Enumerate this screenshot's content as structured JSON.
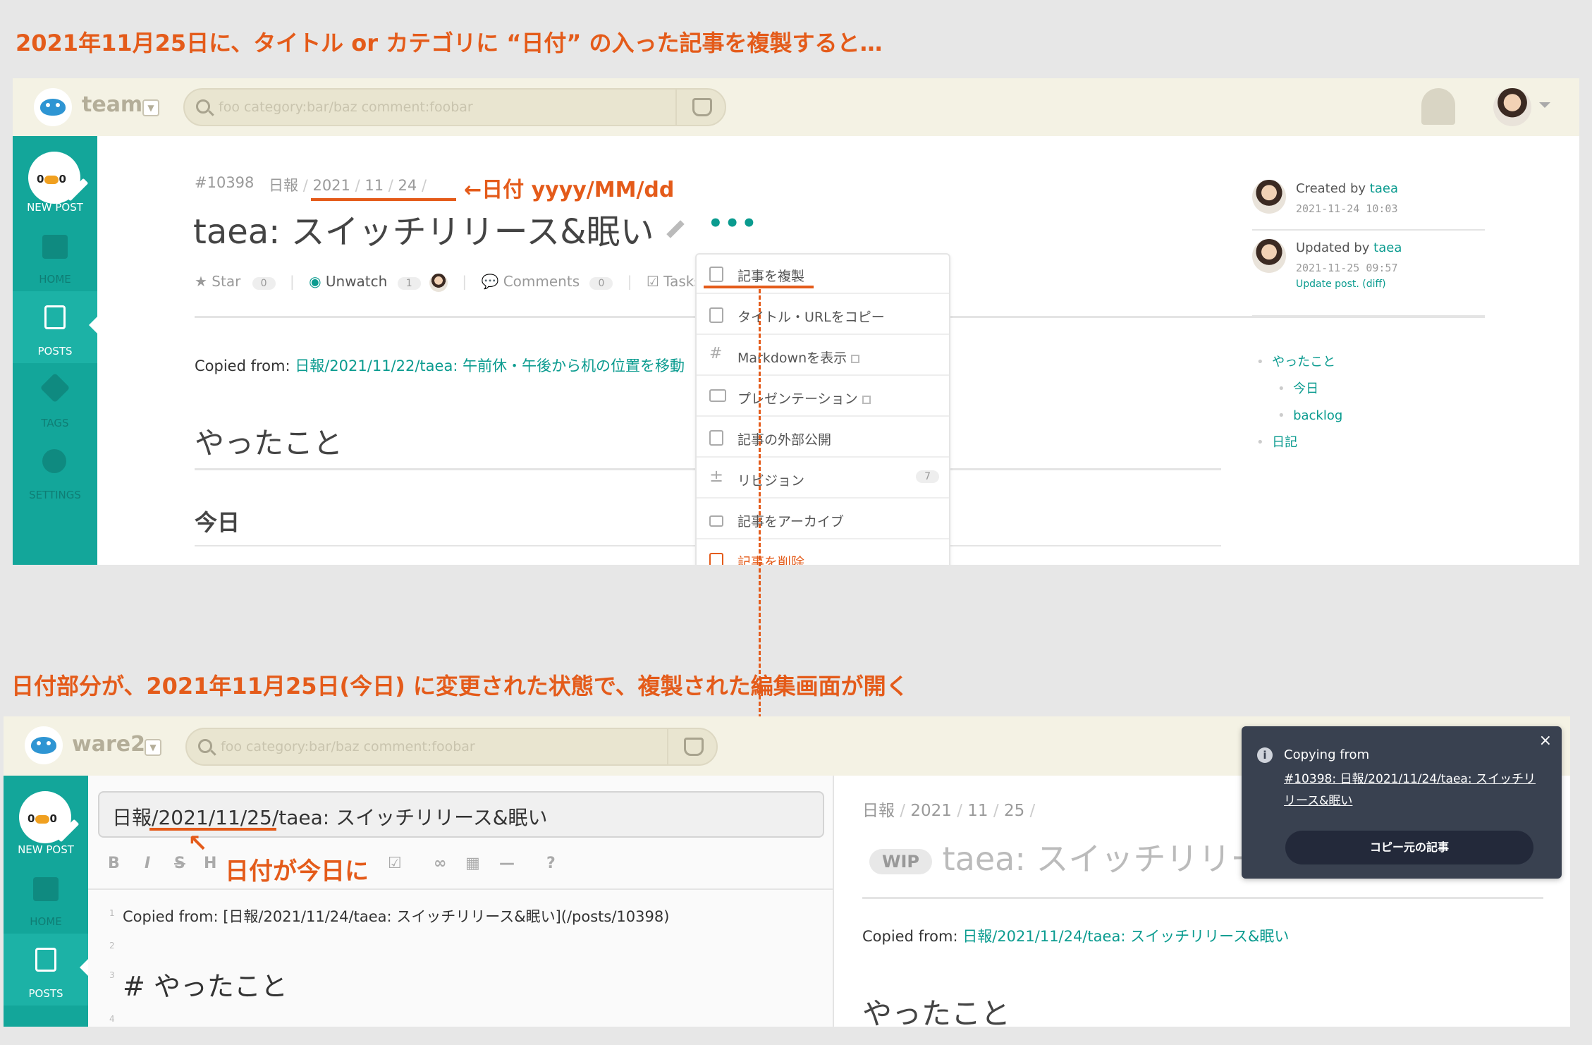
{
  "annotations": {
    "top_heading": "2021年11月25日に、タイトル or カテゴリに “日付” の入った記事を複製すると…",
    "date_format": "←日付 yyyy/MM/dd",
    "mid_heading": "日付部分が、2021年11月25日(今日) に変更された状態で、複製された編集画面が開く",
    "date_today": "日付が今日に",
    "accent_color": "#e45b1a"
  },
  "top": {
    "team": "team",
    "search_placeholder": "foo category:bar/baz comment:foobar",
    "sidebar": {
      "new_post": "NEW POST",
      "home": "HOME",
      "posts": "POSTS",
      "tags": "TAGS",
      "settings": "SETTINGS"
    },
    "post": {
      "number": "#10398",
      "category": "日報",
      "year": "2021",
      "month": "11",
      "day": "24",
      "title": "taea: スイッチリリース&眠い",
      "star": "Star",
      "star_count": "0",
      "unwatch": "Unwatch",
      "watch_count": "1",
      "comments": "Comments",
      "comment_count": "0",
      "tasks": "Tasks",
      "copied_from_label": "Copied from:",
      "copied_from_link": "日報/2021/11/22/taea: 午前休・午後から机の位置を移動",
      "h1": "やったこと",
      "h2": "今日"
    },
    "menu": {
      "duplicate": "記事を複製",
      "copy_title": "タイトル・URLをコピー",
      "markdown": "Markdownを表示",
      "presentation": "プレゼンテーション",
      "share": "記事の外部公開",
      "revision": "リビジョン",
      "revision_count": "7",
      "archive": "記事をアーカイブ",
      "delete": "記事を削除"
    },
    "meta": {
      "created_label": "Created by",
      "created_user": "taea",
      "created_at": "2021-11-24 10:03",
      "updated_label": "Updated by",
      "updated_user": "taea",
      "updated_at": "2021-11-25 09:57",
      "update_note": "Update post. (diff)"
    },
    "toc": [
      "やったこと",
      "今日",
      "backlog",
      "日記"
    ]
  },
  "bottom": {
    "team": "ware2",
    "search_placeholder": "foo category:bar/baz comment:foobar",
    "sidebar": {
      "new_post": "NEW POST",
      "home": "HOME",
      "posts": "POSTS"
    },
    "editor": {
      "title_prefix": "日報/",
      "title_date": "2021/11/25",
      "title_suffix": "/taea: スイッチリリース&眠い",
      "line1": "Copied from: [日報/2021/11/24/taea: スイッチリリース&眠い](/posts/10398)",
      "line3": "# やったこと",
      "toolbar": [
        "B",
        "I",
        "S",
        "H"
      ],
      "line_numbers": [
        "1",
        "2",
        "3",
        "4"
      ]
    },
    "preview": {
      "category": "日報",
      "year": "2021",
      "month": "11",
      "day": "25",
      "wip": "WIP",
      "title": "taea: スイッチリリース&眠い",
      "copied_from_label": "Copied from:",
      "copied_from_link": "日報/2021/11/24/taea: スイッチリリース&眠い",
      "h1": "やったこと"
    },
    "toast": {
      "title": "Copying from",
      "link": "#10398: 日報/2021/11/24/taea: スイッチリリース&眠い",
      "button": "コピー元の記事",
      "close": "×"
    }
  }
}
